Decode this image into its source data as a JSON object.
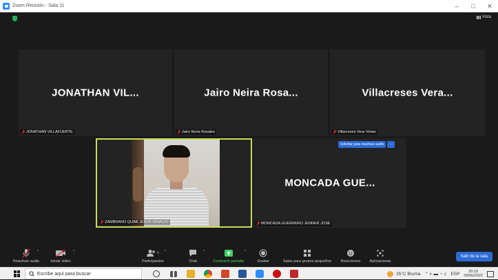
{
  "window": {
    "title": "Zoom Reunión - Sala 11",
    "minimize": "–",
    "maximize": "□",
    "close": "✕"
  },
  "meeting": {
    "view_label": "Vista"
  },
  "participants": [
    {
      "big_name": "JONATHAN VIL...",
      "label": "JONATHAN VILLAFUERTE"
    },
    {
      "big_name": "Jairo Neira Rosa...",
      "label": "Jairo Neira Rosales"
    },
    {
      "big_name": "Villacreses Vera...",
      "label": "Villacreses Vera Vivian"
    },
    {
      "big_name": "",
      "label": "ZAMBRANO QUIMI JESUS IGNACIO"
    },
    {
      "big_name": "MONCADA GUE...",
      "label": "MONCADA GUERRERO JENNER JOSE"
    }
  ],
  "unmute_prompt": {
    "message": "Solicitar para reactivar audio",
    "more": "···"
  },
  "toolbar": {
    "mute": "Reactivar audio",
    "video": "Iniciar video",
    "participants": "Participantes",
    "participants_count": "5",
    "chat": "Chat",
    "share": "Compartir pantalla",
    "record": "Grabar",
    "breakout": "Salas para grupos pequeños",
    "reactions": "Reacciones",
    "apps": "Aplicaciones",
    "leave": "Salir de la sala",
    "caret": "^"
  },
  "taskbar": {
    "search_placeholder": "Escribe aquí para buscar",
    "weather": "25°C Bruma",
    "language": "ESP",
    "time": "20:23",
    "date": "09/06/2022"
  },
  "colors": {
    "accent_blue": "#2d6bd6",
    "active_speaker": "#c5df55",
    "share_green": "#3fd264",
    "muted_red": "#e02828"
  }
}
